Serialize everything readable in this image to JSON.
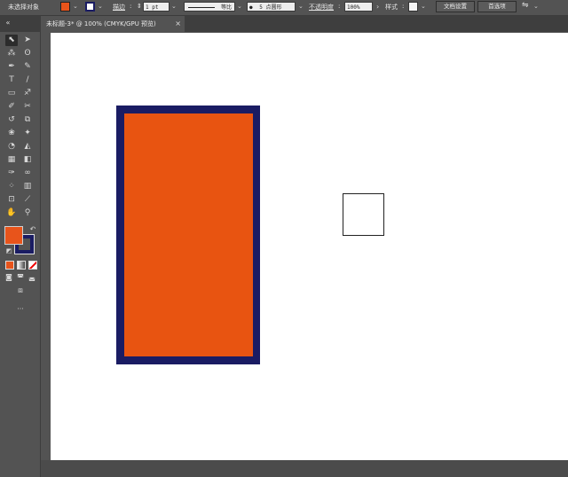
{
  "control_bar": {
    "selection_status": "未选择对象",
    "fill_color": "#e8541b",
    "stroke_color": "#1a1c63",
    "stroke_label": "描边",
    "stroke_weight": "1 pt",
    "stroke_profile": "等比",
    "brush": "5 点圆形",
    "opacity_label": "不透明度",
    "opacity_value": "100%",
    "style_label": "样式",
    "doc_setup_button": "文档设置",
    "preferences_button": "首选项"
  },
  "tab": {
    "title": "未标题-3* @ 100% (CMYK/GPU 预览)",
    "close": "×"
  },
  "toolbar": {
    "expand": "«",
    "more": "···"
  },
  "canvas": {
    "outer_rect_color": "#1a1c63",
    "inner_rect_color": "#e85411",
    "small_rect_fill": "#ffffff"
  }
}
